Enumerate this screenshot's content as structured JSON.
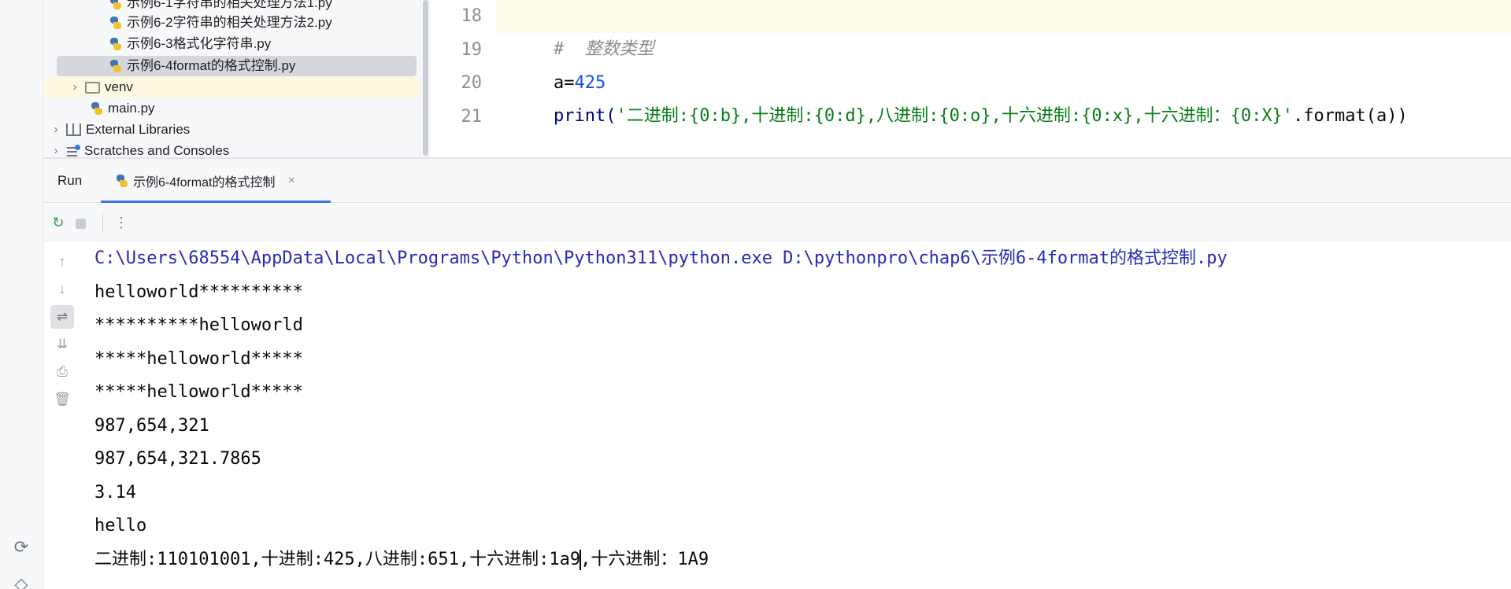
{
  "project_tree": {
    "items": [
      {
        "label": "示例6-1字符串的相关处理方法1.py",
        "kind": "python-file"
      },
      {
        "label": "示例6-2字符串的相关处理方法2.py",
        "kind": "python-file"
      },
      {
        "label": "示例6-3格式化字符串.py",
        "kind": "python-file"
      },
      {
        "label": "示例6-4format的格式控制.py",
        "kind": "python-file",
        "selected": true
      },
      {
        "label": "venv",
        "kind": "folder"
      },
      {
        "label": "main.py",
        "kind": "python-file"
      },
      {
        "label": "External Libraries",
        "kind": "library"
      },
      {
        "label": "Scratches and Consoles",
        "kind": "console"
      }
    ]
  },
  "editor": {
    "line_numbers": [
      "18",
      "19",
      "20",
      "21"
    ],
    "lines": {
      "l18_comment": "#  整数类型",
      "l19_var": "a=",
      "l19_num": "425",
      "l20_fn": "print(",
      "l20_str": "'二进制:{0:b},十进制:{0:d},八进制:{0:o},十六进制:{0:x},十六进制：{0:X}'",
      "l20_tail": ".format(a))"
    }
  },
  "run_panel": {
    "label": "Run",
    "tab_title": "示例6-4format的格式控制",
    "close_glyph": "×"
  },
  "console": {
    "command": "C:\\Users\\68554\\AppData\\Local\\Programs\\Python\\Python311\\python.exe D:\\pythonpro\\chap6\\示例6-4format的格式控制.py",
    "output": [
      "helloworld**********",
      "**********helloworld",
      "*****helloworld*****",
      "*****helloworld*****",
      "987,654,321",
      "987,654,321.7865",
      "3.14",
      "hello"
    ],
    "last_line_before_caret": "二进制:110101001,十进制:425,八进制:651,十六进制:1a9",
    "last_line_after_caret": ",十六进制：1A9"
  },
  "icons": {
    "python_icon": "python-file-icon",
    "folder_icon": "folder-icon",
    "rerun_icon": "rerun-icon",
    "stop_icon": "stop-icon",
    "more_icon": "more-options-icon"
  },
  "colors": {
    "accent": "#3574f0",
    "string": "#067d17",
    "number": "#1750eb",
    "comment": "#8c8c8c",
    "console_command": "#2a2ab5",
    "selection": "#d5d7dc"
  }
}
